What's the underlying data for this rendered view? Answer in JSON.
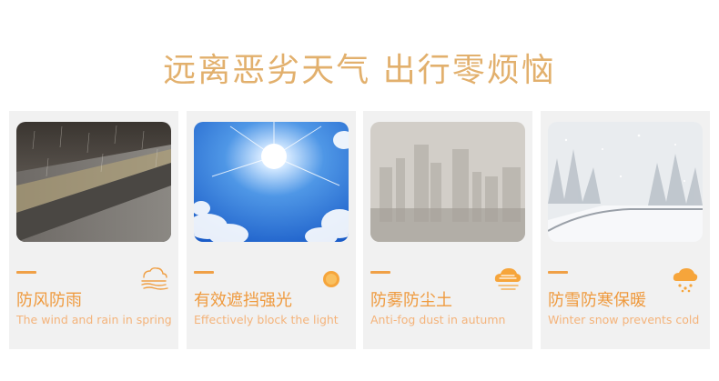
{
  "header": {
    "title": "远离恶劣天气 出行零烦恼"
  },
  "cards": [
    {
      "cn": "防风防雨",
      "en": "The wind and rain in spring",
      "icon": "wind-rain-icon"
    },
    {
      "cn": "有效遮挡强光",
      "en": "Effectively block the light",
      "icon": "sun-icon"
    },
    {
      "cn": "防雾防尘土",
      "en": "Anti-fog dust in autumn",
      "icon": "fog-cloud-icon"
    },
    {
      "cn": "防雪防寒保暖",
      "en": "Winter snow prevents  cold",
      "icon": "snow-cloud-icon"
    }
  ],
  "colors": {
    "accent": "#f0a046",
    "title": "#e2b06d",
    "card_bg": "#f1f1f1"
  }
}
